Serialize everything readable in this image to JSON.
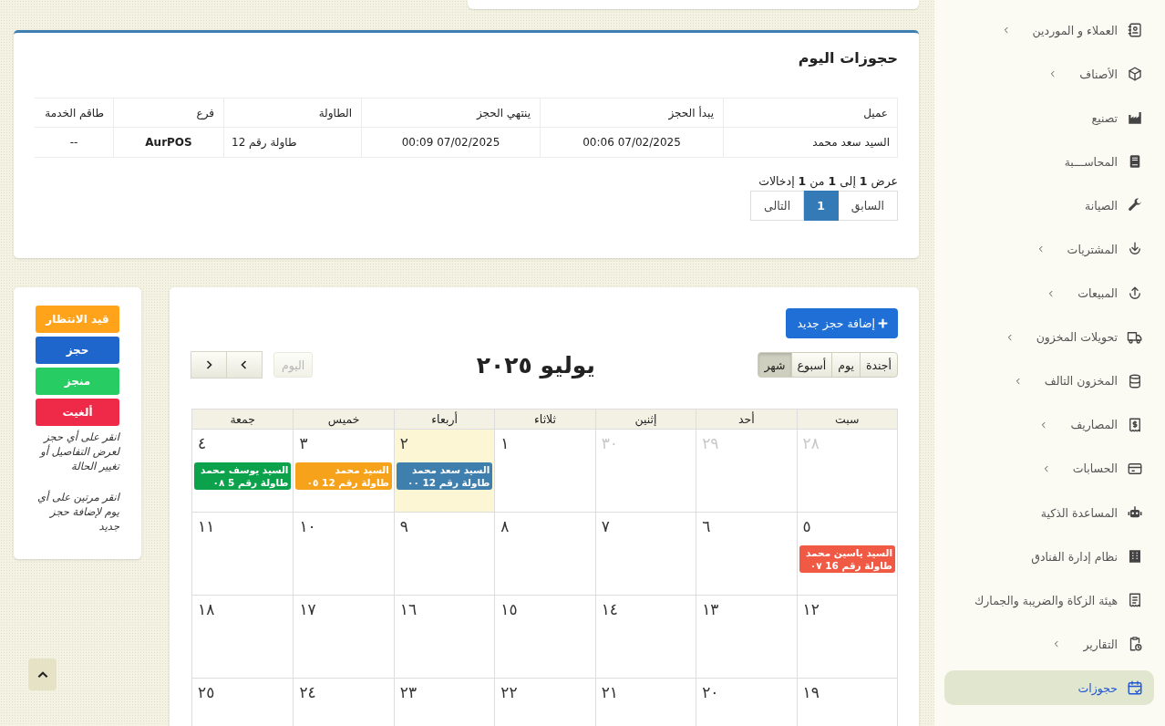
{
  "sidebar": {
    "items": [
      {
        "label": "العملاء و الموردين",
        "has_submenu": true,
        "selected": false
      },
      {
        "label": "الأصناف",
        "has_submenu": true,
        "selected": false
      },
      {
        "label": "تصنيع",
        "has_submenu": false,
        "selected": false
      },
      {
        "label": "المحاســـبة",
        "has_submenu": false,
        "selected": false
      },
      {
        "label": "الصيانة",
        "has_submenu": false,
        "selected": false
      },
      {
        "label": "المشتريات",
        "has_submenu": true,
        "selected": false
      },
      {
        "label": "المبيعات",
        "has_submenu": true,
        "selected": false
      },
      {
        "label": "تحويلات المخزون",
        "has_submenu": true,
        "selected": false
      },
      {
        "label": "المخزون التالف",
        "has_submenu": true,
        "selected": false
      },
      {
        "label": "المصاريف",
        "has_submenu": true,
        "selected": false
      },
      {
        "label": "الحسابات",
        "has_submenu": true,
        "selected": false
      },
      {
        "label": "المساعدة الذكية",
        "has_submenu": false,
        "selected": false
      },
      {
        "label": "نظام إدارة الفنادق",
        "has_submenu": false,
        "selected": false
      },
      {
        "label": "هيئة الزكاة والضريبة والجمارك",
        "has_submenu": false,
        "selected": false
      },
      {
        "label": "التقارير",
        "has_submenu": true,
        "selected": false
      },
      {
        "label": "حجوزات",
        "has_submenu": false,
        "selected": true
      }
    ]
  },
  "today_bookings": {
    "title": "حجوزات اليوم",
    "columns": [
      "عميل",
      "يبدأ الحجز",
      "ينتهي الحجز",
      "الطاولة",
      "فرع",
      "طاقم الخدمة"
    ],
    "rows": [
      [
        "السيد سعد محمد",
        "07/02/2025 00:06",
        "07/02/2025 00:09",
        "طاولة رقم 12",
        "AurPOS",
        "--"
      ]
    ],
    "info": "عرض **1** إلى **1** من **1** إدخالات",
    "pagination": [
      {
        "label": "السابق",
        "selected": false
      },
      {
        "label": "1",
        "selected": true
      },
      {
        "label": "التالى",
        "selected": false
      }
    ]
  },
  "calendar": {
    "add_button": "إضافة حجز جديد",
    "title": "يوليو ٢٠٢٥",
    "views": [
      {
        "label": "أجندة",
        "selected": false
      },
      {
        "label": "يوم",
        "selected": false
      },
      {
        "label": "أسبوع",
        "selected": false
      },
      {
        "label": "شهر",
        "selected": true
      }
    ],
    "today_button": {
      "label": "اليوم",
      "disabled": true
    },
    "weekdays": [
      "سبت",
      "أحد",
      "إثنين",
      "ثلاثاء",
      "أربعاء",
      "خميس",
      "جمعة"
    ],
    "weeks": [
      {
        "days": [
          {
            "number": "٢٨",
            "other_month": true,
            "today": false
          },
          {
            "number": "٢٩",
            "other_month": true,
            "today": false
          },
          {
            "number": "٣٠",
            "other_month": true,
            "today": false
          },
          {
            "number": "١",
            "other_month": false,
            "today": false
          },
          {
            "number": "٢",
            "other_month": false,
            "today": true,
            "events": [
              {
                "name": "السيد سعد محمد",
                "detail": "طاولة رقم 12 ٠٠",
                "color": "#3f7fae"
              }
            ]
          },
          {
            "number": "٣",
            "other_month": false,
            "today": false,
            "events": [
              {
                "name": "السيد محمد",
                "detail": "طاولة رقم 12 ٠٥",
                "color": "#f7a21b"
              }
            ]
          },
          {
            "number": "٤",
            "other_month": false,
            "today": false,
            "events": [
              {
                "name": "السيد يوسف محمد",
                "detail": "طاولة رقم 5 ٠٨",
                "color": "#0ca24c"
              }
            ]
          }
        ]
      },
      {
        "days": [
          {
            "number": "٥",
            "other_month": false,
            "today": false,
            "events": [
              {
                "name": "السيد ياسين محمد",
                "detail": "طاولة رقم 16 ٠٧",
                "color": "#f05a44"
              }
            ]
          },
          {
            "number": "٦",
            "other_month": false,
            "today": false
          },
          {
            "number": "٧",
            "other_month": false,
            "today": false
          },
          {
            "number": "٨",
            "other_month": false,
            "today": false
          },
          {
            "number": "٩",
            "other_month": false,
            "today": false
          },
          {
            "number": "١٠",
            "other_month": false,
            "today": false
          },
          {
            "number": "١١",
            "other_month": false,
            "today": false
          }
        ]
      },
      {
        "days": [
          {
            "number": "١٢",
            "other_month": false,
            "today": false
          },
          {
            "number": "١٣",
            "other_month": false,
            "today": false
          },
          {
            "number": "١٤",
            "other_month": false,
            "today": false
          },
          {
            "number": "١٥",
            "other_month": false,
            "today": false
          },
          {
            "number": "١٦",
            "other_month": false,
            "today": false
          },
          {
            "number": "١٧",
            "other_month": false,
            "today": false
          },
          {
            "number": "١٨",
            "other_month": false,
            "today": false
          }
        ]
      },
      {
        "days": [
          {
            "number": "١٩",
            "other_month": false,
            "today": false
          },
          {
            "number": "٢٠",
            "other_month": false,
            "today": false
          },
          {
            "number": "٢١",
            "other_month": false,
            "today": false
          },
          {
            "number": "٢٢",
            "other_month": false,
            "today": false
          },
          {
            "number": "٢٣",
            "other_month": false,
            "today": false
          },
          {
            "number": "٢٤",
            "other_month": false,
            "today": false
          },
          {
            "number": "٢٥",
            "other_month": false,
            "today": false
          }
        ]
      }
    ]
  },
  "legend": {
    "statuses": [
      {
        "label": "قيد الانتظار",
        "color": "#ffa31a"
      },
      {
        "label": "حجز",
        "color": "#1f66cc"
      },
      {
        "label": "منجز",
        "color": "#27cc63"
      },
      {
        "label": "ألغيت",
        "color": "#ee2a48"
      }
    ],
    "help": [
      "انقر على أي حجز لعرض التفاصيل أو تغيير الحالة",
      "انقر مرتين على أي يوم لإضافة حجز جديد"
    ]
  }
}
